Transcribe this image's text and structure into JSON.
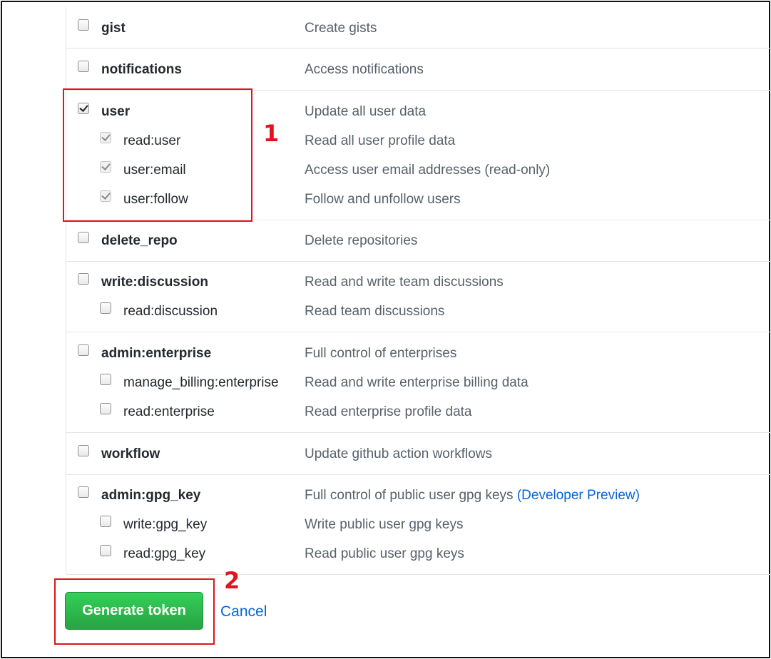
{
  "scopes": [
    {
      "name": "gist",
      "description": "Create gists",
      "checked": false
    },
    {
      "name": "notifications",
      "description": "Access notifications",
      "checked": false
    },
    {
      "name": "user",
      "description": "Update all user data",
      "checked": true,
      "children": [
        {
          "name": "read:user",
          "description": "Read all user profile data",
          "checked": true
        },
        {
          "name": "user:email",
          "description": "Access user email addresses (read-only)",
          "checked": true
        },
        {
          "name": "user:follow",
          "description": "Follow and unfollow users",
          "checked": true
        }
      ]
    },
    {
      "name": "delete_repo",
      "description": "Delete repositories",
      "checked": false
    },
    {
      "name": "write:discussion",
      "description": "Read and write team discussions",
      "checked": false,
      "children": [
        {
          "name": "read:discussion",
          "description": "Read team discussions",
          "checked": false
        }
      ]
    },
    {
      "name": "admin:enterprise",
      "description": "Full control of enterprises",
      "checked": false,
      "children": [
        {
          "name": "manage_billing:enterprise",
          "description": "Read and write enterprise billing data",
          "checked": false
        },
        {
          "name": "read:enterprise",
          "description": "Read enterprise profile data",
          "checked": false
        }
      ]
    },
    {
      "name": "workflow",
      "description": "Update github action workflows",
      "checked": false
    },
    {
      "name": "admin:gpg_key",
      "description": "Full control of public user gpg keys",
      "badge": "(Developer Preview)",
      "checked": false,
      "children": [
        {
          "name": "write:gpg_key",
          "description": "Write public user gpg keys",
          "checked": false
        },
        {
          "name": "read:gpg_key",
          "description": "Read public user gpg keys",
          "checked": false
        }
      ]
    }
  ],
  "actions": {
    "generate_label": "Generate token",
    "cancel_label": "Cancel"
  },
  "annotations": {
    "marker_1": "1",
    "marker_2": "2",
    "color": "#e0141e"
  },
  "colors": {
    "primary_button": "#2ea44f",
    "link": "#0366d6",
    "description_text": "#586069"
  }
}
